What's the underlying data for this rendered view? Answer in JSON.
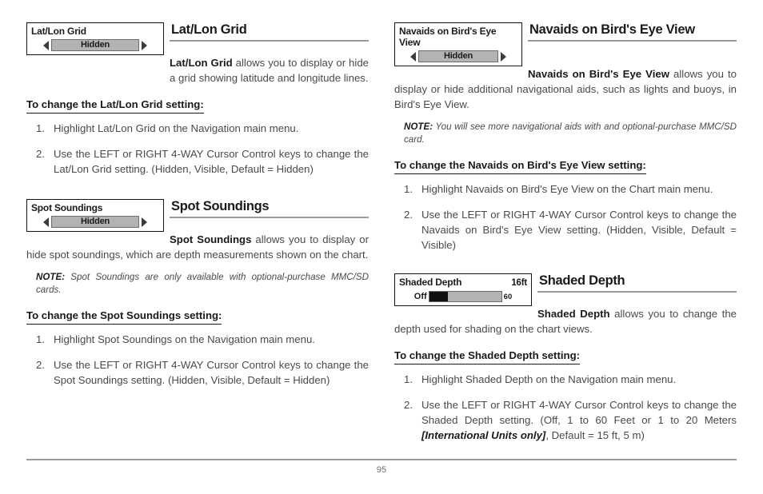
{
  "page": {
    "number": "95"
  },
  "left_column": {
    "sections": [
      {
        "id": "latlon",
        "widget": {
          "title": "Lat/Lon Grid",
          "value": "Hidden",
          "left_arrow": "left-arrow-icon",
          "right_arrow": "right-arrow-icon"
        },
        "heading": "Lat/Lon Grid",
        "lead_bold": "Lat/Lon Grid",
        "lead_rest": " allows you to display or hide a grid showing latitude and longitude lines.",
        "sub_heading": "To change the Lat/Lon Grid setting:",
        "steps": [
          {
            "num": "1.",
            "text": "Highlight Lat/Lon Grid on the Navigation main menu."
          },
          {
            "num": "2.",
            "text": "Use the LEFT or RIGHT 4-WAY Cursor Control keys to change the Lat/Lon Grid setting. (Hidden, Visible, Default = Hidden)"
          }
        ]
      },
      {
        "id": "spot",
        "widget": {
          "title": "Spot Soundings",
          "value": "Hidden",
          "left_arrow": "left-arrow-icon",
          "right_arrow": "right-arrow-icon"
        },
        "heading": "Spot Soundings",
        "lead_bold": "Spot Soundings",
        "lead_rest": " allows you to display or hide spot soundings, which are depth measurements shown on the chart.",
        "note_keyword": "NOTE:",
        "note_text": " Spot Soundings are only available with optional-purchase MMC/SD cards.",
        "sub_heading": "To change the Spot Soundings setting:",
        "steps": [
          {
            "num": "1.",
            "text": "Highlight Spot Soundings on the Navigation main menu."
          },
          {
            "num": "2.",
            "text": "Use the LEFT or RIGHT 4-WAY Cursor Control keys to change the Spot Soundings setting. (Hidden, Visible, Default = Hidden)"
          }
        ]
      }
    ]
  },
  "right_column": {
    "sections": [
      {
        "id": "navaids",
        "widget": {
          "title": "Navaids on Bird's Eye View",
          "value": "Hidden",
          "left_arrow": "left-arrow-icon",
          "right_arrow": "right-arrow-icon"
        },
        "heading": "Navaids on Bird's Eye View",
        "lead_bold": "Navaids on Bird's Eye View",
        "lead_rest": " allows you to display or hide additional navigational aids, such as lights and buoys, in Bird's Eye View.",
        "note_keyword": "NOTE:",
        "note_text": " You will see more navigational aids with and optional-purchase MMC/SD card.",
        "sub_heading": "To change the Navaids on Bird's Eye View setting:",
        "steps": [
          {
            "num": "1.",
            "text": "Highlight Navaids on Bird's Eye View on the Chart main menu."
          },
          {
            "num": "2.",
            "text": "Use the LEFT or RIGHT 4-WAY Cursor Control keys to change the Navaids on Bird's Eye View setting. (Hidden, Visible, Default = Visible)"
          }
        ]
      },
      {
        "id": "shaded",
        "widget": {
          "title": "Shaded Depth",
          "value_right": "16ft",
          "slider_min_label": "Off",
          "slider_max_label": "60",
          "slider_fill_percent": 26
        },
        "heading": "Shaded Depth",
        "lead_bold": "Shaded Depth",
        "lead_rest": " allows you to change the depth used for shading on the chart views.",
        "sub_heading": "To change the Shaded Depth setting:",
        "steps": [
          {
            "num": "1.",
            "text": "Highlight Shaded Depth on the Navigation main menu."
          },
          {
            "num": "2.",
            "text_before": "Use the LEFT or RIGHT 4-WAY Cursor Control keys to change the Shaded Depth setting. (Off, 1 to 60 Feet or 1 to 20 Meters ",
            "text_bold_italic": "[International Units only]",
            "text_after": ", Default = 15 ft, 5 m)"
          }
        ]
      }
    ]
  }
}
